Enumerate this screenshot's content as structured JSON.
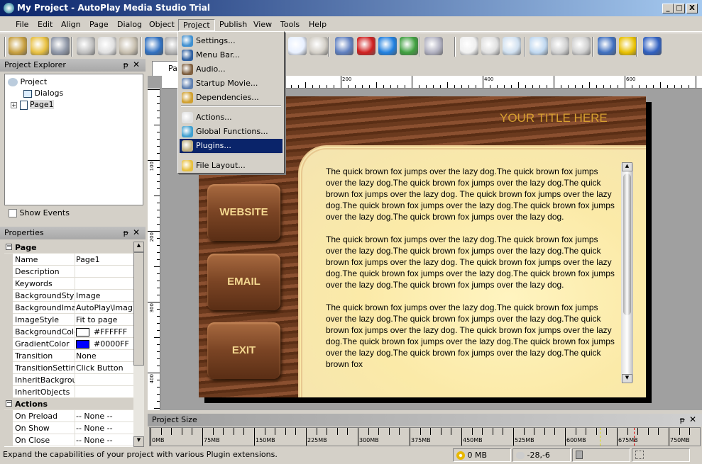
{
  "window": {
    "title": "My Project - AutoPlay Media Studio Trial",
    "min": "_",
    "max": "□",
    "close": "X"
  },
  "menubar": [
    {
      "label": "File"
    },
    {
      "label": "Edit"
    },
    {
      "label": "Align"
    },
    {
      "label": "Page"
    },
    {
      "label": "Dialog"
    },
    {
      "label": "Object"
    },
    {
      "label": "Project"
    },
    {
      "label": "Publish"
    },
    {
      "label": "View"
    },
    {
      "label": "Tools"
    },
    {
      "label": "Help"
    }
  ],
  "project_menu": {
    "items": [
      {
        "label": "Settings...",
        "icon": "settings-icon"
      },
      {
        "label": "Menu Bar...",
        "icon": "menubar-icon"
      },
      {
        "label": "Audio...",
        "icon": "audio-icon"
      },
      {
        "label": "Startup Movie...",
        "icon": "movie-icon"
      },
      {
        "label": "Dependencies...",
        "icon": "dependencies-icon"
      },
      {
        "label": "Actions...",
        "icon": "actions-icon"
      },
      {
        "label": "Global Functions...",
        "icon": "globe-icon"
      },
      {
        "label": "Plugins...",
        "icon": "plugin-icon",
        "selected": true
      },
      {
        "label": "File Layout...",
        "icon": "file-layout-icon"
      }
    ]
  },
  "explorer": {
    "title": "Project Explorer",
    "pin": "ᵽ",
    "close": "✕",
    "tree": [
      {
        "label": "Project"
      },
      {
        "label": "Dialogs"
      },
      {
        "label": "Page1"
      }
    ],
    "show_events": "Show Events"
  },
  "properties": {
    "title": "Properties",
    "categories": [
      {
        "name": "Page",
        "rows": [
          [
            "Name",
            "Page1"
          ],
          [
            "Description",
            ""
          ],
          [
            "Keywords",
            ""
          ],
          [
            "BackgroundStyle",
            "Image"
          ],
          [
            "BackgroundImage",
            "AutoPlay\\Images"
          ],
          [
            "ImageStyle",
            "Fit to page"
          ],
          [
            "BackgroundColor",
            "#FFFFFF"
          ],
          [
            "GradientColor",
            "#0000FF"
          ],
          [
            "Transition",
            "None"
          ],
          [
            "TransitionSettings",
            "Click Button"
          ],
          [
            "InheritBackground",
            ""
          ],
          [
            "InheritObjects",
            ""
          ]
        ]
      },
      {
        "name": "Actions",
        "rows": [
          [
            "On Preload",
            "-- None --"
          ],
          [
            "On Show",
            "-- None --"
          ],
          [
            "On Close",
            "-- None --"
          ]
        ]
      }
    ],
    "colors": {
      "background": "#FFFFFF",
      "gradient": "#0000FF"
    }
  },
  "editor": {
    "tab": "Page1",
    "hruler": [
      "200",
      "400",
      "600"
    ],
    "vruler": [
      "100",
      "200",
      "300",
      "400"
    ]
  },
  "page": {
    "title": "YOUR TITLE HERE",
    "buttons": [
      "WEBSITE",
      "EMAIL",
      "EXIT"
    ],
    "paragraphs": [
      "The quick brown fox jumps over the lazy dog.The quick brown fox jumps over the lazy dog.The quick brown fox jumps over the lazy dog.The quick brown fox jumps over the lazy dog. The quick brown fox jumps over the lazy dog.The quick brown fox jumps over the lazy dog.The quick brown fox jumps over the lazy dog.The quick brown fox jumps over the lazy dog.",
      "The quick brown fox jumps over the lazy dog.The quick brown fox jumps over the lazy dog.The quick brown fox jumps over the lazy dog.The quick brown fox jumps over the lazy dog. The quick brown fox jumps over the lazy dog.The quick brown fox jumps over the lazy dog.The quick brown fox jumps over the lazy dog.The quick brown fox jumps over the lazy dog.",
      "The quick brown fox jumps over the lazy dog.The quick brown fox jumps over the lazy dog.The quick brown fox jumps over the lazy dog.The quick brown fox jumps over the lazy dog. The quick brown fox jumps over the lazy dog.The quick brown fox jumps over the lazy dog.The quick brown fox jumps over the lazy dog.The quick brown fox jumps over the lazy dog.The quick brown fox"
    ]
  },
  "project_size": {
    "title": "Project Size",
    "labels": [
      "0MB",
      "75MB",
      "150MB",
      "225MB",
      "300MB",
      "375MB",
      "450MB",
      "525MB",
      "600MB",
      "675MB",
      "750MB"
    ],
    "markers": [
      {
        "value_mb": 650,
        "color": "#e0e000"
      },
      {
        "value_mb": 700,
        "color": "#e00000"
      }
    ]
  },
  "status": {
    "message": "Expand the capabilities of your project with various Plugin extensions.",
    "size": "0 MB",
    "coords": "-28,-6"
  }
}
